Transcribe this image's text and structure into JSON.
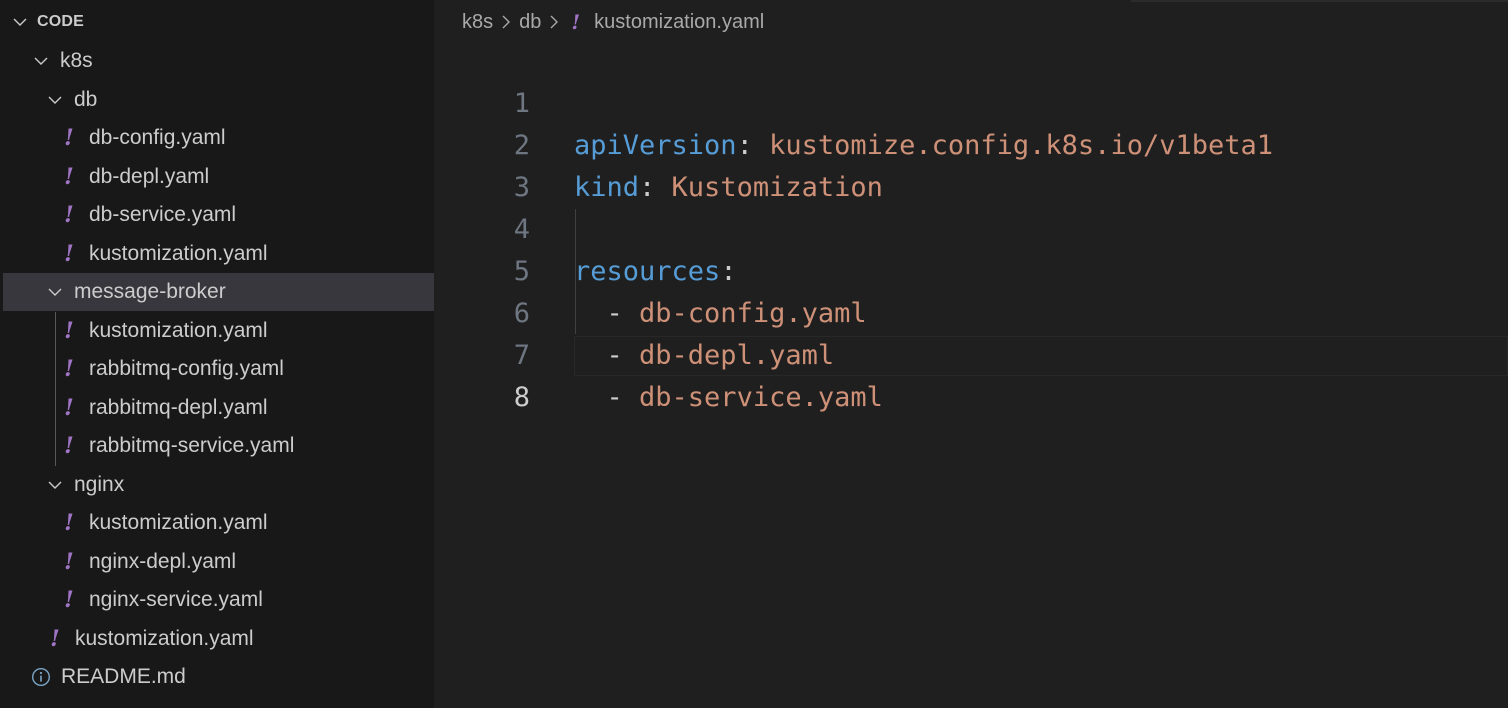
{
  "explorer": {
    "section_title": "CODE",
    "items": [
      {
        "label": "k8s",
        "kind": "folder"
      },
      {
        "label": "db",
        "kind": "folder"
      },
      {
        "label": "db-config.yaml",
        "kind": "yaml"
      },
      {
        "label": "db-depl.yaml",
        "kind": "yaml"
      },
      {
        "label": "db-service.yaml",
        "kind": "yaml"
      },
      {
        "label": "kustomization.yaml",
        "kind": "yaml"
      },
      {
        "label": "message-broker",
        "kind": "folder",
        "selected": true
      },
      {
        "label": "kustomization.yaml",
        "kind": "yaml"
      },
      {
        "label": "rabbitmq-config.yaml",
        "kind": "yaml"
      },
      {
        "label": "rabbitmq-depl.yaml",
        "kind": "yaml"
      },
      {
        "label": "rabbitmq-service.yaml",
        "kind": "yaml"
      },
      {
        "label": "nginx",
        "kind": "folder"
      },
      {
        "label": "kustomization.yaml",
        "kind": "yaml"
      },
      {
        "label": "nginx-depl.yaml",
        "kind": "yaml"
      },
      {
        "label": "nginx-service.yaml",
        "kind": "yaml"
      },
      {
        "label": "kustomization.yaml",
        "kind": "yaml"
      },
      {
        "label": "README.md",
        "kind": "info"
      }
    ],
    "yaml_icon_glyph": "!"
  },
  "breadcrumb": {
    "items": [
      "k8s",
      "db"
    ],
    "file_icon": "!",
    "file": "kustomization.yaml"
  },
  "editor": {
    "lines": [
      {
        "num": "1",
        "key": "apiVersion",
        "punc": ": ",
        "value": "kustomize.config.k8s.io/v1beta1"
      },
      {
        "num": "2",
        "key": "kind",
        "punc": ": ",
        "value": "Kustomization"
      },
      {
        "num": "3",
        "key": "",
        "punc": "",
        "value": ""
      },
      {
        "num": "4",
        "key": "resources",
        "punc": ":",
        "value": ""
      },
      {
        "num": "5",
        "key": "",
        "punc": "  - ",
        "value": "db-config.yaml"
      },
      {
        "num": "6",
        "key": "",
        "punc": "  - ",
        "value": "db-depl.yaml"
      },
      {
        "num": "7",
        "key": "",
        "punc": "  - ",
        "value": "db-service.yaml"
      },
      {
        "num": "8",
        "key": "",
        "punc": "",
        "value": ""
      }
    ],
    "active_line": "8"
  },
  "colors": {
    "sidebar_bg": "#181818",
    "editor_bg": "#1f1f1f",
    "yaml_icon": "#a074c4",
    "key": "#569cd6",
    "string": "#ce9178",
    "selected_row": "#37373d"
  }
}
